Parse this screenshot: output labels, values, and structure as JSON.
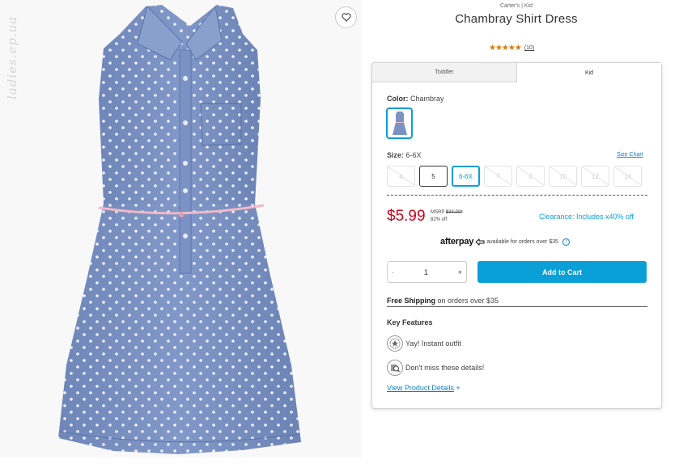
{
  "watermark": "ladies.ep.ua",
  "product": {
    "brand_line": "Carter's | Kid",
    "title": "Chambray Shirt Dress",
    "stars": "★★★★★",
    "review_count": "(10)"
  },
  "tabs": [
    {
      "label": "Toddler",
      "active": false
    },
    {
      "label": "Kid",
      "active": true
    }
  ],
  "color": {
    "label": "Color:",
    "value": "Chambray"
  },
  "size": {
    "label": "Size:",
    "value": "6-6X",
    "chart_link": "Size Chart",
    "options": [
      {
        "label": "4",
        "state": "disabled"
      },
      {
        "label": "5",
        "state": "available"
      },
      {
        "label": "6-6X",
        "state": "selected"
      },
      {
        "label": "7",
        "state": "disabled"
      },
      {
        "label": "8",
        "state": "disabled"
      },
      {
        "label": "10",
        "state": "disabled"
      },
      {
        "label": "12",
        "state": "disabled"
      },
      {
        "label": "14",
        "state": "disabled"
      }
    ]
  },
  "pricing": {
    "price": "$5.99",
    "msrp_label": "MSRP",
    "msrp_value": "$34.00*",
    "discount": "82% off",
    "clearance": "Clearance: Includes x40% off"
  },
  "afterpay": {
    "logo": "afterpay",
    "text": "available for orders over $35",
    "info": "i"
  },
  "quantity": {
    "minus": "-",
    "value": "1",
    "plus": "+"
  },
  "add_to_cart": "Add to Cart",
  "shipping": {
    "bold": "Free Shipping",
    "rest": "on orders over $35"
  },
  "features": {
    "title": "Key Features",
    "items": [
      {
        "label": "Yay! Instant outfit",
        "icon": "star-badge-icon"
      },
      {
        "label": "Don't miss these details!",
        "icon": "magnifier-icon"
      }
    ]
  },
  "view_details": {
    "label": "View Product Details",
    "plus": "+"
  },
  "colors": {
    "accent": "#0b9fd8",
    "price_red": "#d0021b",
    "star_orange": "#e07a00",
    "dress_blue": "#7b93c4"
  }
}
